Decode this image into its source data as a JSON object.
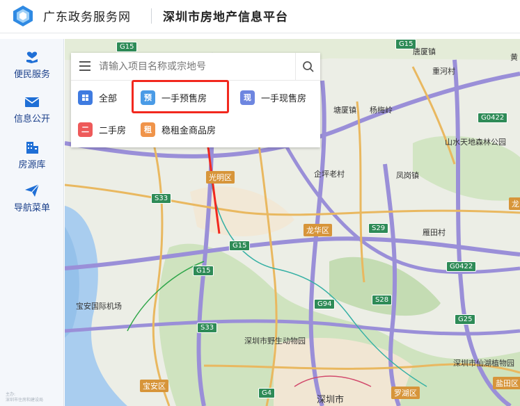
{
  "header": {
    "portal_name": "广东政务服务网",
    "platform_name": "深圳市房地产信息平台"
  },
  "sidebar": {
    "items": [
      {
        "label": "便民服务",
        "icon": "heart-hand-icon"
      },
      {
        "label": "信息公开",
        "icon": "envelope-icon"
      },
      {
        "label": "房源库",
        "icon": "building-icon"
      },
      {
        "label": "导航菜单",
        "icon": "paper-plane-icon"
      }
    ],
    "footer": "主办:\n深圳市住房和建设局"
  },
  "search": {
    "placeholder": "请输入项目名称或宗地号"
  },
  "categories": [
    {
      "badge": "",
      "label": "全部",
      "color": "#3f7be0"
    },
    {
      "badge": "预",
      "label": "一手预售房",
      "color": "#4a9be6"
    },
    {
      "badge": "现",
      "label": "一手现售房",
      "color": "#6e86e0"
    },
    {
      "badge": "二",
      "label": "二手房",
      "color": "#ee5a5a"
    },
    {
      "badge": "租",
      "label": "稳租金商品房",
      "color": "#f0944a"
    }
  ],
  "map": {
    "districts": [
      "光明区",
      "龙华区",
      "宝安区",
      "罗湖区",
      "盐田区",
      "龙岗"
    ],
    "places": [
      "塘厦镇",
      "杨梅岭",
      "重河村",
      "凤岗镇",
      "企坪老村",
      "雁田村",
      "宝安国际机场",
      "深圳市野生动物园",
      "深圳市",
      "山水天地森林公园",
      "深圳市仙湖植物园",
      "唐厦镇",
      "黄"
    ],
    "roads": [
      "G15",
      "G15",
      "G15",
      "S33",
      "S33",
      "G94",
      "S29",
      "S28",
      "G0422",
      "G0422",
      "G25",
      "G4",
      "G15"
    ]
  },
  "colors": {
    "highlight": "#f2281e",
    "sidebar_text": "#1a3f8a",
    "district_badge": "#d7953a",
    "road_shield": "#2e8b57"
  }
}
